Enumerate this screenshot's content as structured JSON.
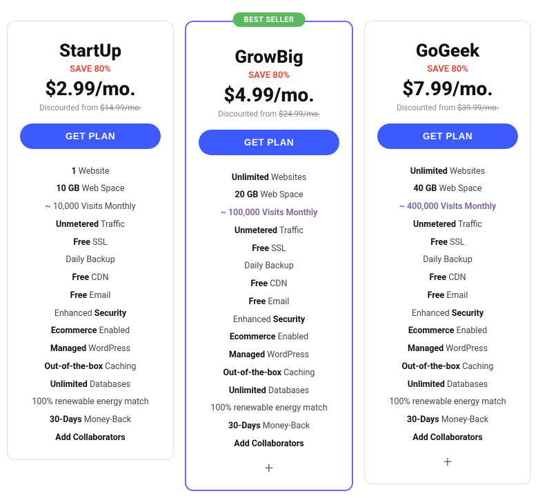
{
  "plans": [
    {
      "id": "startup",
      "name": "StartUp",
      "save": "SAVE 80%",
      "price": "$2.99/mo.",
      "discount_text": "Discounted from",
      "original_price": "$14.99/mo.",
      "cta": "GET PLAN",
      "featured": false,
      "best_seller": false,
      "features": [
        {
          "text": "1 Website",
          "bold_part": "1"
        },
        {
          "text": "10 GB Web Space",
          "bold_part": "10 GB"
        },
        {
          "text": "~ 10,000 Visits Monthly",
          "bold_part": null
        },
        {
          "text": "Unmetered Traffic",
          "bold_part": "Unmetered"
        },
        {
          "text": "Free SSL",
          "bold_part": "Free"
        },
        {
          "text": "Daily Backup",
          "bold_part": null
        },
        {
          "text": "Free CDN",
          "bold_part": "Free"
        },
        {
          "text": "Free Email",
          "bold_part": "Free"
        },
        {
          "text": "Enhanced Security",
          "bold_part": "Security"
        },
        {
          "text": "Ecommerce Enabled",
          "bold_part": "Ecommerce"
        },
        {
          "text": "Managed WordPress",
          "bold_part": "Managed"
        },
        {
          "text": "Out-of-the-box Caching",
          "bold_part": "Out-of-the-box"
        },
        {
          "text": "Unlimited Databases",
          "bold_part": "Unlimited"
        },
        {
          "text": "100% renewable energy match",
          "bold_part": null
        },
        {
          "text": "30-Days Money-Back",
          "bold_part": "30-Days"
        },
        {
          "text": "Add Collaborators",
          "bold_part": "Add Collaborators"
        }
      ],
      "show_plus": false
    },
    {
      "id": "growbig",
      "name": "GrowBig",
      "save": "SAVE 80%",
      "price": "$4.99/mo.",
      "discount_text": "Discounted from",
      "original_price": "$24.99/mo.",
      "cta": "GET PLAN",
      "featured": true,
      "best_seller": true,
      "best_seller_label": "BEST SELLER",
      "features": [
        {
          "text": "Unlimited Websites",
          "bold_part": "Unlimited"
        },
        {
          "text": "20 GB Web Space",
          "bold_part": "20 GB"
        },
        {
          "text": "~ 100,000 Visits Monthly",
          "bold_part": null,
          "highlight": true
        },
        {
          "text": "Unmetered Traffic",
          "bold_part": "Unmetered"
        },
        {
          "text": "Free SSL",
          "bold_part": "Free"
        },
        {
          "text": "Daily Backup",
          "bold_part": null
        },
        {
          "text": "Free CDN",
          "bold_part": "Free"
        },
        {
          "text": "Free Email",
          "bold_part": "Free"
        },
        {
          "text": "Enhanced Security",
          "bold_part": "Security"
        },
        {
          "text": "Ecommerce Enabled",
          "bold_part": "Ecommerce"
        },
        {
          "text": "Managed WordPress",
          "bold_part": "Managed"
        },
        {
          "text": "Out-of-the-box Caching",
          "bold_part": "Out-of-the-box"
        },
        {
          "text": "Unlimited Databases",
          "bold_part": "Unlimited"
        },
        {
          "text": "100% renewable energy match",
          "bold_part": null
        },
        {
          "text": "30-Days Money-Back",
          "bold_part": "30-Days"
        },
        {
          "text": "Add Collaborators",
          "bold_part": "Add Collaborators"
        }
      ],
      "show_plus": true
    },
    {
      "id": "gogeek",
      "name": "GoGeek",
      "save": "SAVE 80%",
      "price": "$7.99/mo.",
      "discount_text": "Discounted from",
      "original_price": "$39.99/mo.",
      "cta": "GET PLAN",
      "featured": false,
      "best_seller": false,
      "features": [
        {
          "text": "Unlimited Websites",
          "bold_part": "Unlimited"
        },
        {
          "text": "40 GB Web Space",
          "bold_part": "40 GB"
        },
        {
          "text": "~ 400,000 Visits Monthly",
          "bold_part": null,
          "highlight": true
        },
        {
          "text": "Unmetered Traffic",
          "bold_part": "Unmetered"
        },
        {
          "text": "Free SSL",
          "bold_part": "Free"
        },
        {
          "text": "Daily Backup",
          "bold_part": null
        },
        {
          "text": "Free CDN",
          "bold_part": "Free"
        },
        {
          "text": "Free Email",
          "bold_part": "Free"
        },
        {
          "text": "Enhanced Security",
          "bold_part": "Security"
        },
        {
          "text": "Ecommerce Enabled",
          "bold_part": "Ecommerce"
        },
        {
          "text": "Managed WordPress",
          "bold_part": "Managed"
        },
        {
          "text": "Out-of-the-box Caching",
          "bold_part": "Out-of-the-box"
        },
        {
          "text": "Unlimited Databases",
          "bold_part": "Unlimited"
        },
        {
          "text": "100% renewable energy match",
          "bold_part": null
        },
        {
          "text": "30-Days Money-Back",
          "bold_part": "30-Days"
        },
        {
          "text": "Add Collaborators",
          "bold_part": "Add Collaborators"
        }
      ],
      "show_plus": true
    }
  ]
}
